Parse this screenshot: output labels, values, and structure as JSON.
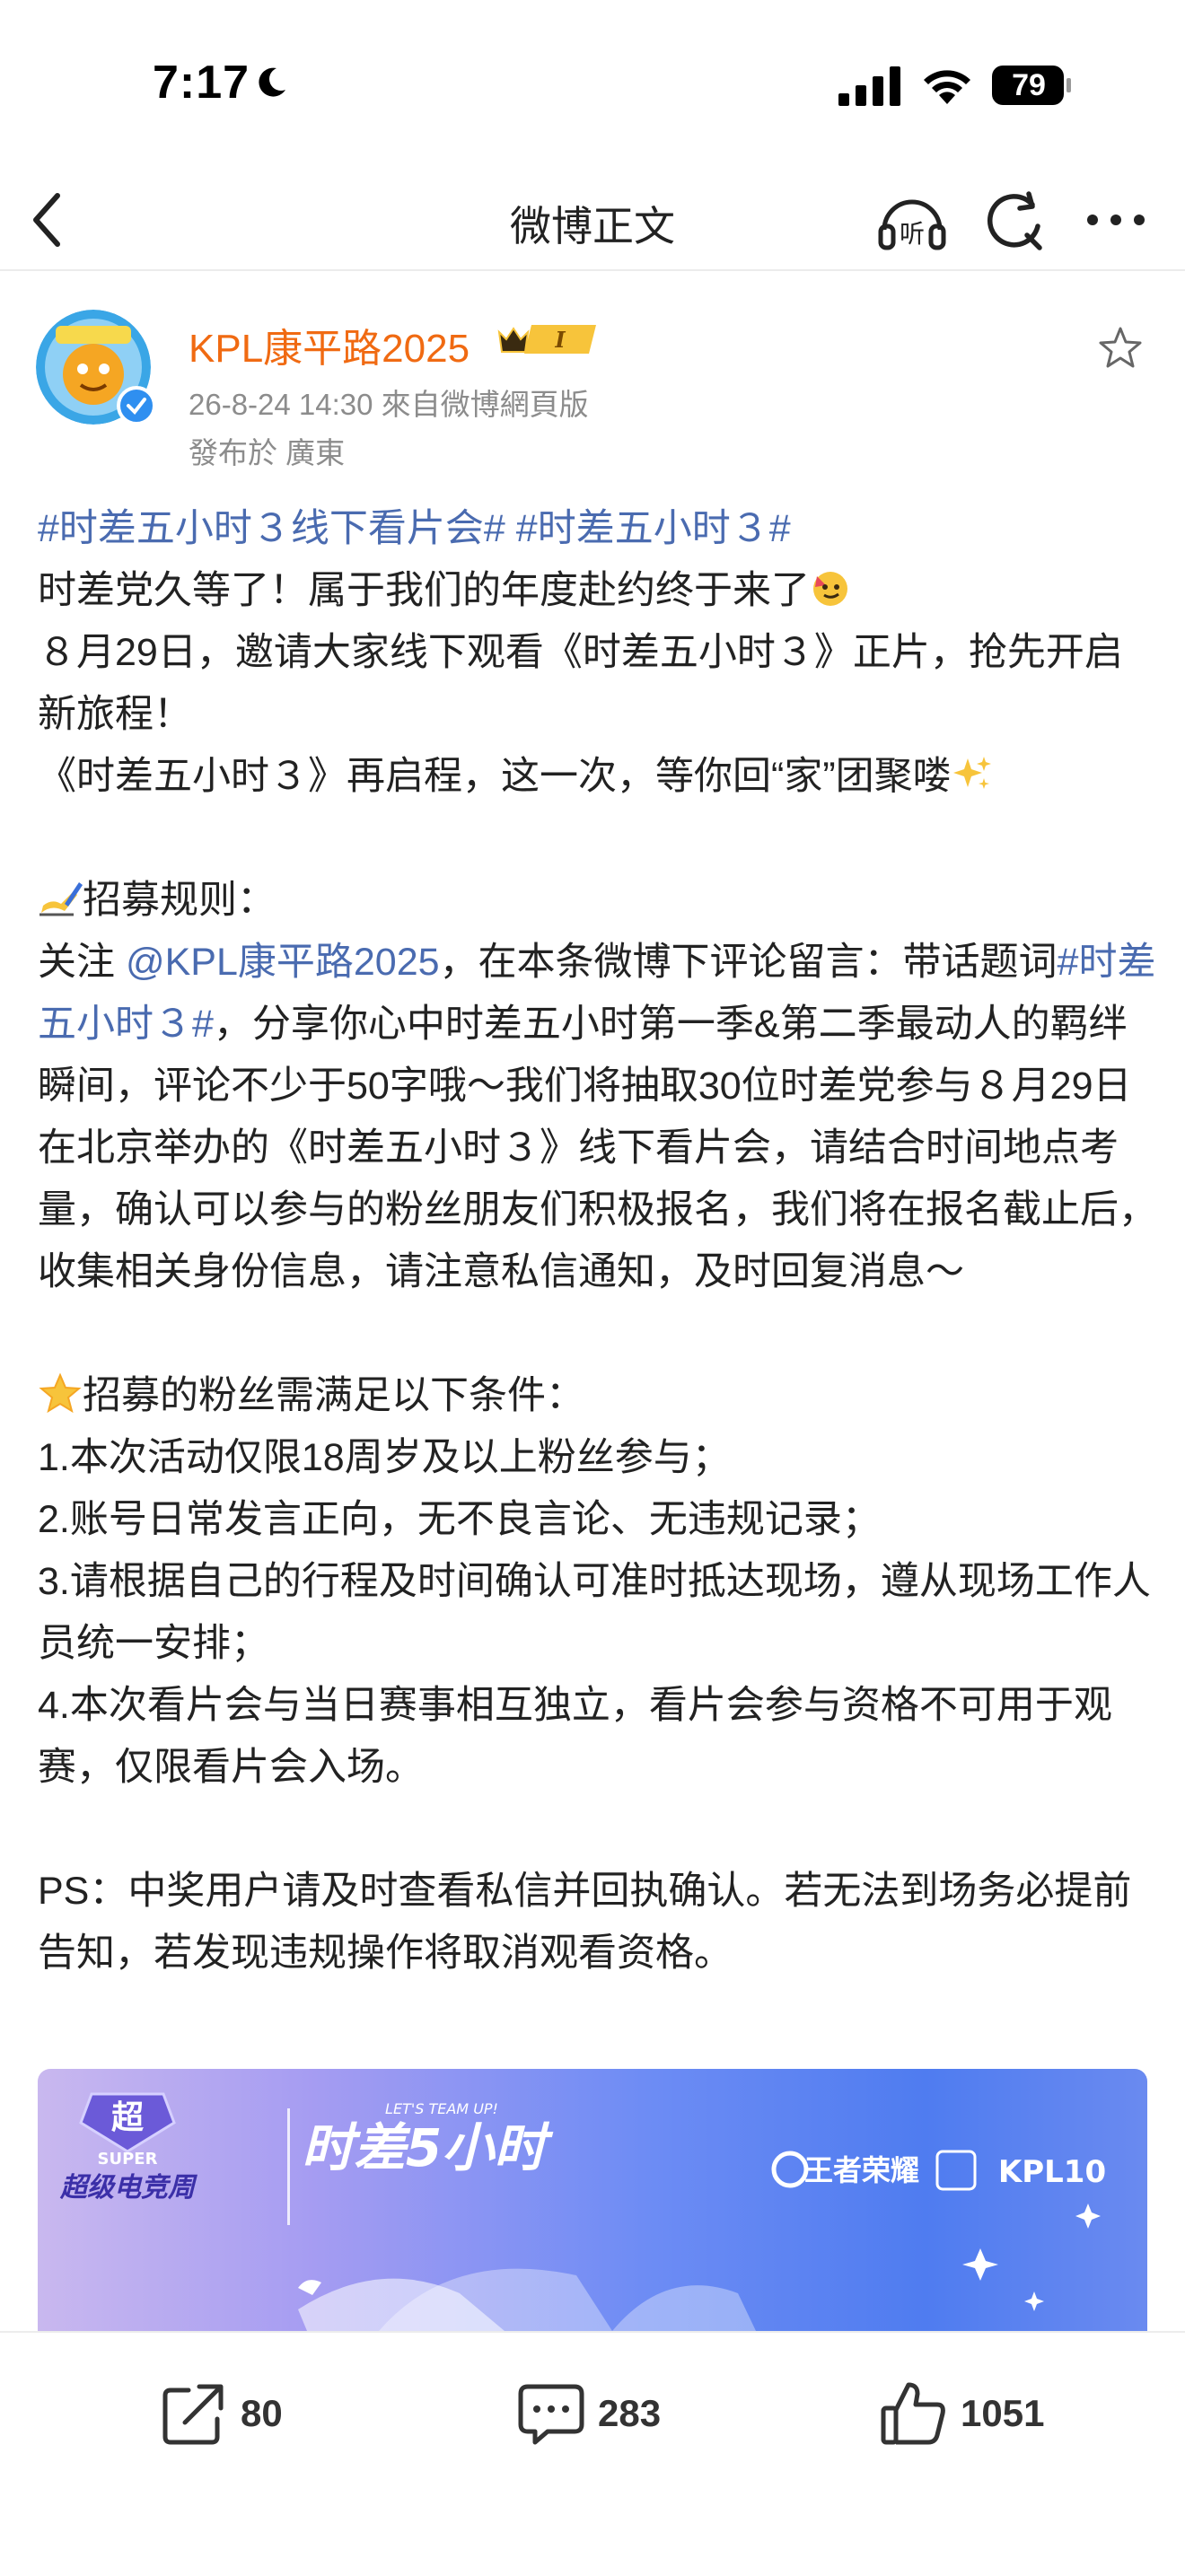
{
  "status_bar": {
    "time": "7:17",
    "battery": "79"
  },
  "nav": {
    "title": "微博正文"
  },
  "author": {
    "name": "KPL康平路2025",
    "vip_level": "I",
    "meta": "26-8-24 14:30  來自微博網頁版",
    "location": "發布於 廣東"
  },
  "post": {
    "tags_line": "#时差五小时３线下看片会# #时差五小时３#",
    "line1": "时差党久等了！属于我们的年度赴约终于来了",
    "line2": "８月29日，邀请大家线下观看《时差五小时３》正片，抢先开启新旅程！",
    "line3": "《时差五小时３》再启程，这一次，等你回“家”团聚喽",
    "rules_heading": "招募规则：",
    "rules_prefix": "关注 ",
    "rules_mention": "@KPL康平路2025",
    "rules_mid": "，在本条微博下评论留言：带话题词",
    "rules_tag": "#时差五小时３#",
    "rules_rest": "，分享你心中时差五小时第一季&第二季最动人的羁绊瞬间，评论不少于50字哦～我们将抽取30位时差党参与８月29日在北京举办的《时差五小时３》线下看片会，请结合时间地点考量，确认可以参与的粉丝朋友们积极报名，我们将在报名截止后，收集相关身份信息，请注意私信通知，及时回复消息～",
    "conditions_heading": "招募的粉丝需满足以下条件：",
    "conditions": [
      "1.本次活动仅限18周岁及以上粉丝参与；",
      "2.账号日常发言正向，无不良言论、无违规记录；",
      "3.请根据自己的行程及时间确认可准时抵达现场，遵从现场工作人员统一安排；",
      "4.本次看片会与当日赛事相互独立，看片会参与资格不可用于观赛，仅限看片会入场。"
    ],
    "ps": "PS：中奖用户请及时查看私信并回执确认。若无法到场务必提前告知，若发现违规操作将取消观看资格。"
  },
  "banner": {
    "logo_top": "超",
    "logo_sub": "SUPER",
    "logo_cn": "超级电竞周",
    "show_title": "时差5小时",
    "show_sub": "LET'S TEAM UP!",
    "brand1": "王者荣耀",
    "brand2": "KPL10"
  },
  "actions": {
    "share_count": "80",
    "comment_count": "283",
    "like_count": "1051"
  },
  "colors": {
    "accent_orange": "#f06a12",
    "link_blue": "#4a6bb0",
    "meta_gray": "#8c8c8c"
  }
}
